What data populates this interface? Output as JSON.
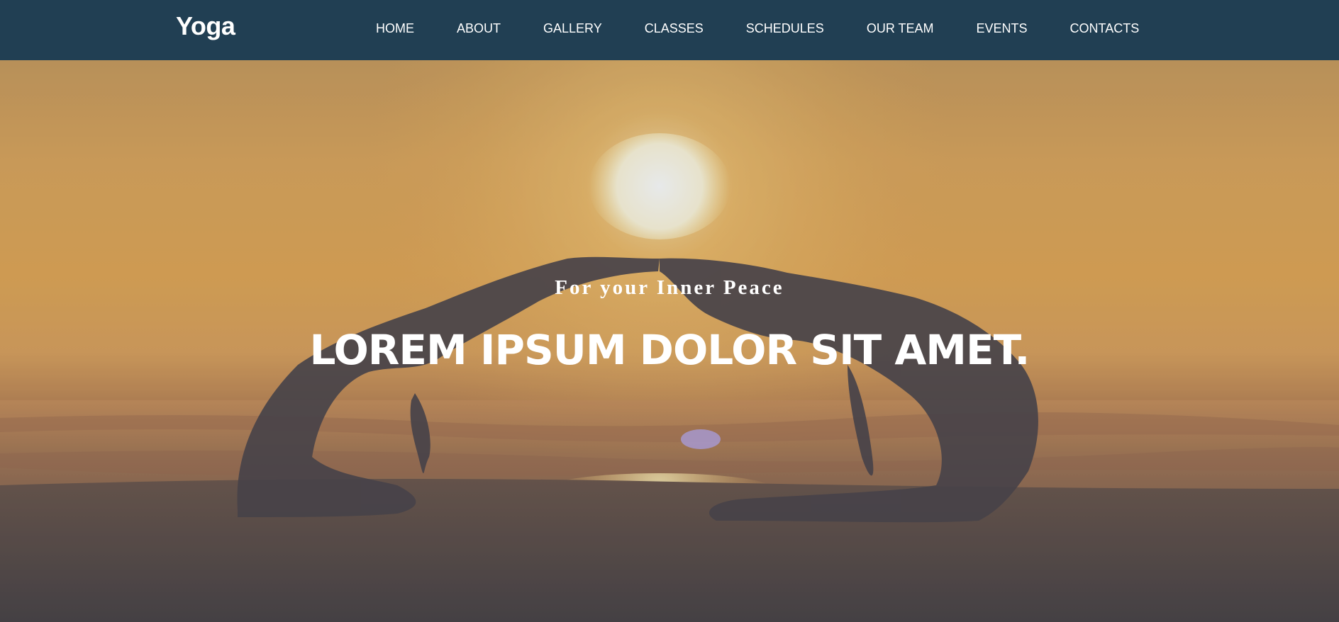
{
  "brand": {
    "name": "Yoga"
  },
  "nav": {
    "items": [
      {
        "label": "HOME"
      },
      {
        "label": "ABOUT"
      },
      {
        "label": "GALLERY"
      },
      {
        "label": "CLASSES"
      },
      {
        "label": "SCHEDULES"
      },
      {
        "label": "OUR TEAM"
      },
      {
        "label": "EVENTS"
      },
      {
        "label": "CONTACTS"
      }
    ]
  },
  "hero": {
    "subtitle": "For your Inner Peace",
    "title": "LOREM IPSUM DOLOR SIT AMET."
  },
  "colors": {
    "navbar_bg": "#213f53",
    "text": "#ffffff",
    "sky": "#e3a653",
    "sun": "#fff6d8",
    "silhouette": "#4a4248"
  }
}
